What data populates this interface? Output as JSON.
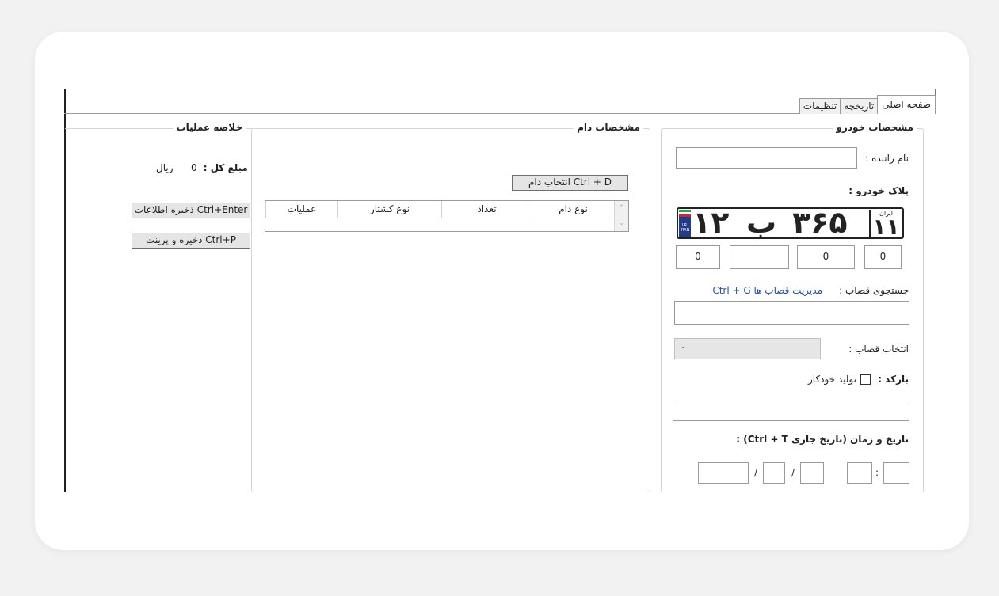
{
  "tabs": [
    {
      "label": "صفحه اصلی",
      "active": true
    },
    {
      "label": "تاریخچه",
      "active": false
    },
    {
      "label": "تنظیمات",
      "active": false
    }
  ],
  "vehicle": {
    "title": "مشخصات خودرو",
    "driver_label": "نام راننده :",
    "driver_value": "",
    "plate_label": "پلاک خودرو :",
    "plate": {
      "left_digits": "۱۲",
      "letter": "ب",
      "middle_digits": "۳۶۵",
      "region_label": "ایران",
      "region_digits": "۱۱",
      "flag_code": "I.R. IRAN"
    },
    "plate_fields": [
      "0",
      "",
      "0",
      "0"
    ],
    "butcher_search_label": "جستجوی قصاب :",
    "butcher_manage_link": "مدیریت قصاب ها Ctrl + G",
    "butcher_search_value": "",
    "butcher_select_label": "انتخاب قصاب :",
    "butcher_select_value": "",
    "barcode_label": "بارکد :",
    "auto_generate_label": "تولید خودکار",
    "auto_generate_checked": false,
    "barcode_value": "",
    "datetime_label": "تاریخ و زمان (تاریخ جاری Ctrl + T) :",
    "date_sep": "/",
    "time_sep": ":"
  },
  "livestock": {
    "title": "مشخصات دام",
    "select_button": "انتخاب دام Ctrl + D",
    "columns": [
      "نوع دام",
      "تعداد",
      "نوع کشتار",
      "عملیات"
    ],
    "rows": []
  },
  "summary": {
    "title": "خلاصه عملیات",
    "total_label": "مبلغ کل :",
    "total_value": "0",
    "currency": "ریال",
    "save_button": "ذخیره اطلاعات Ctrl+Enter",
    "save_print_button": "ذخیره و پرینت Ctrl+P"
  },
  "colors": {
    "link": "#1f4fb3",
    "flag_blue": "#1f3c8f",
    "flag_green": "#27a84b",
    "flag_red": "#d6232b"
  }
}
